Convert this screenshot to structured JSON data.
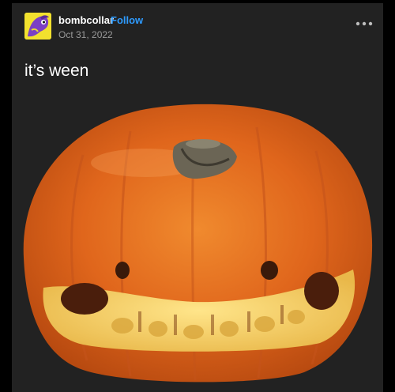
{
  "post": {
    "username": "bombcollar",
    "follow_label": "Follow",
    "date": "Oct 31, 2022",
    "caption": "it’s ween"
  },
  "icons": {
    "avatar": "purple-bird-avatar",
    "more": "more-dots-icon"
  },
  "colors": {
    "background": "#000000",
    "card": "#222222",
    "follow": "#2e9bff",
    "pumpkin": "#e0661c"
  }
}
